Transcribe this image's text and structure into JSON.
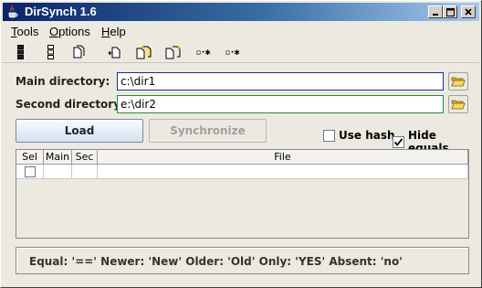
{
  "window": {
    "title": "DirSynch 1.6"
  },
  "menu": [
    {
      "label": "Tools",
      "mnemonic": "T",
      "rest": "ools"
    },
    {
      "label": "Options",
      "mnemonic": "O",
      "rest": "ptions"
    },
    {
      "label": "Help",
      "mnemonic": "H",
      "rest": "elp"
    }
  ],
  "toolbar": {
    "icons": [
      "select-all-icon",
      "select-none-icon",
      "file-copy-icon",
      "copy-left-icon",
      "copy-both-icon",
      "copy-right-icon",
      "filter-equal-icon",
      "filter-diff-icon"
    ],
    "filter_equal_text": "▫·✱",
    "filter_diff_text": "▫·✱"
  },
  "form": {
    "main_label": "Main directory:",
    "main_value": "c:\\dir1",
    "second_label": "Second directory:",
    "second_value": "e:\\dir2",
    "main_border_color": "#1a2a9a",
    "second_border_color": "#2a8a3a"
  },
  "actions": {
    "load_label": "Load",
    "synchronize_label": "Synchronize",
    "use_hash_label": "Use hash",
    "use_hash_checked": false,
    "hide_equals_label": "Hide equals",
    "hide_equals_checked": true
  },
  "table": {
    "columns": [
      "Sel",
      "Main",
      "Sec",
      "File"
    ],
    "rows": [
      {
        "sel": false,
        "main": "",
        "sec": "",
        "file": ""
      }
    ]
  },
  "status": {
    "text": "Equal: '==' Newer: 'New' Older: 'Old' Only: 'YES' Absent: 'no'"
  }
}
